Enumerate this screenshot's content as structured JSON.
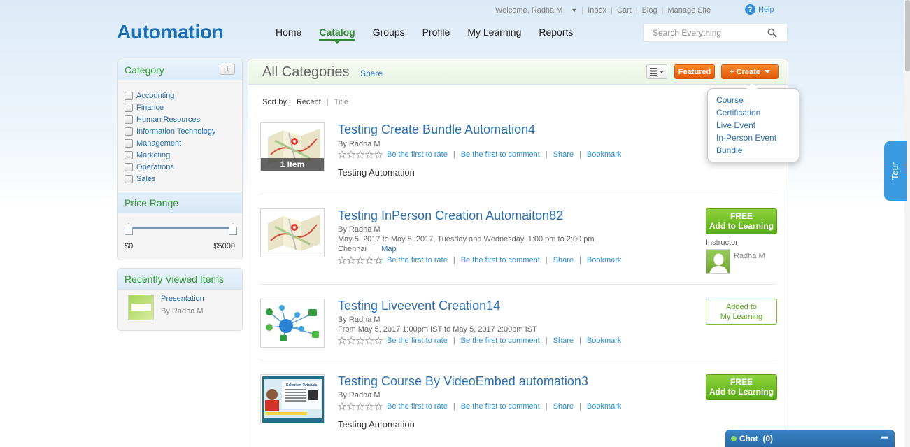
{
  "topbar": {
    "welcome": "Welcome, Radha M",
    "links": [
      "Inbox",
      "Cart",
      "Blog",
      "Manage Site"
    ],
    "help": "Help"
  },
  "logo": "Automation",
  "nav": {
    "items": [
      "Home",
      "Catalog",
      "Groups",
      "Profile",
      "My Learning",
      "Reports"
    ],
    "active": "Catalog"
  },
  "search": {
    "placeholder": "Search Everything"
  },
  "sidebar": {
    "category_title": "Category",
    "categories": [
      "Accounting",
      "Finance",
      "Human Resources",
      "Information Technology",
      "Management",
      "Marketing",
      "Operations",
      "Sales"
    ],
    "price_title": "Price Range",
    "price_min": "$0",
    "price_max": "$5000",
    "recent_title": "Recently Viewed Items",
    "recent_item": {
      "title": "Presentation",
      "by": "By Radha M"
    }
  },
  "content": {
    "title": "All Categories",
    "share": "Share",
    "featured": "Featured",
    "create": "+ Create",
    "sort_label": "Sort by :",
    "sort_options": [
      "Recent",
      "Title"
    ]
  },
  "create_menu": [
    "Course",
    "Certification",
    "Live Event",
    "In-Person Event",
    "Bundle"
  ],
  "rating_links": {
    "rate": "Be the first to rate",
    "comment": "Be the first to comment",
    "share": "Share",
    "bookmark": "Bookmark"
  },
  "items": [
    {
      "title": "Testing Create Bundle Automation4",
      "by": "By Radha M",
      "badge": "1 Item",
      "desc": "Testing Automation"
    },
    {
      "title": "Testing InPerson Creation Automaiton82",
      "by": "By Radha M",
      "date": "May 5, 2017 to May 5, 2017, Tuesday and Wednesday, 1:00 pm to 2:00 pm",
      "location": "Chennai",
      "map": "Map",
      "btn_line1": "FREE",
      "btn_line2": "Add to Learning",
      "instructor_label": "Instructor",
      "instructor_name": "Radha M"
    },
    {
      "title": "Testing Liveevent Creation14",
      "by": "By Radha M",
      "date": "From May 5, 2017 1:00pm IST to May 5, 2017 2:00pm IST",
      "added_line1": "Added to",
      "added_line2": "My Learning"
    },
    {
      "title": "Testing Course By VideoEmbed automation3",
      "by": "By Radha M",
      "desc": "Testing Automation",
      "btn_line1": "FREE",
      "btn_line2": "Add to Learning"
    }
  ],
  "tour": "Tour",
  "chat": {
    "label": "Chat",
    "count": "(0)"
  }
}
